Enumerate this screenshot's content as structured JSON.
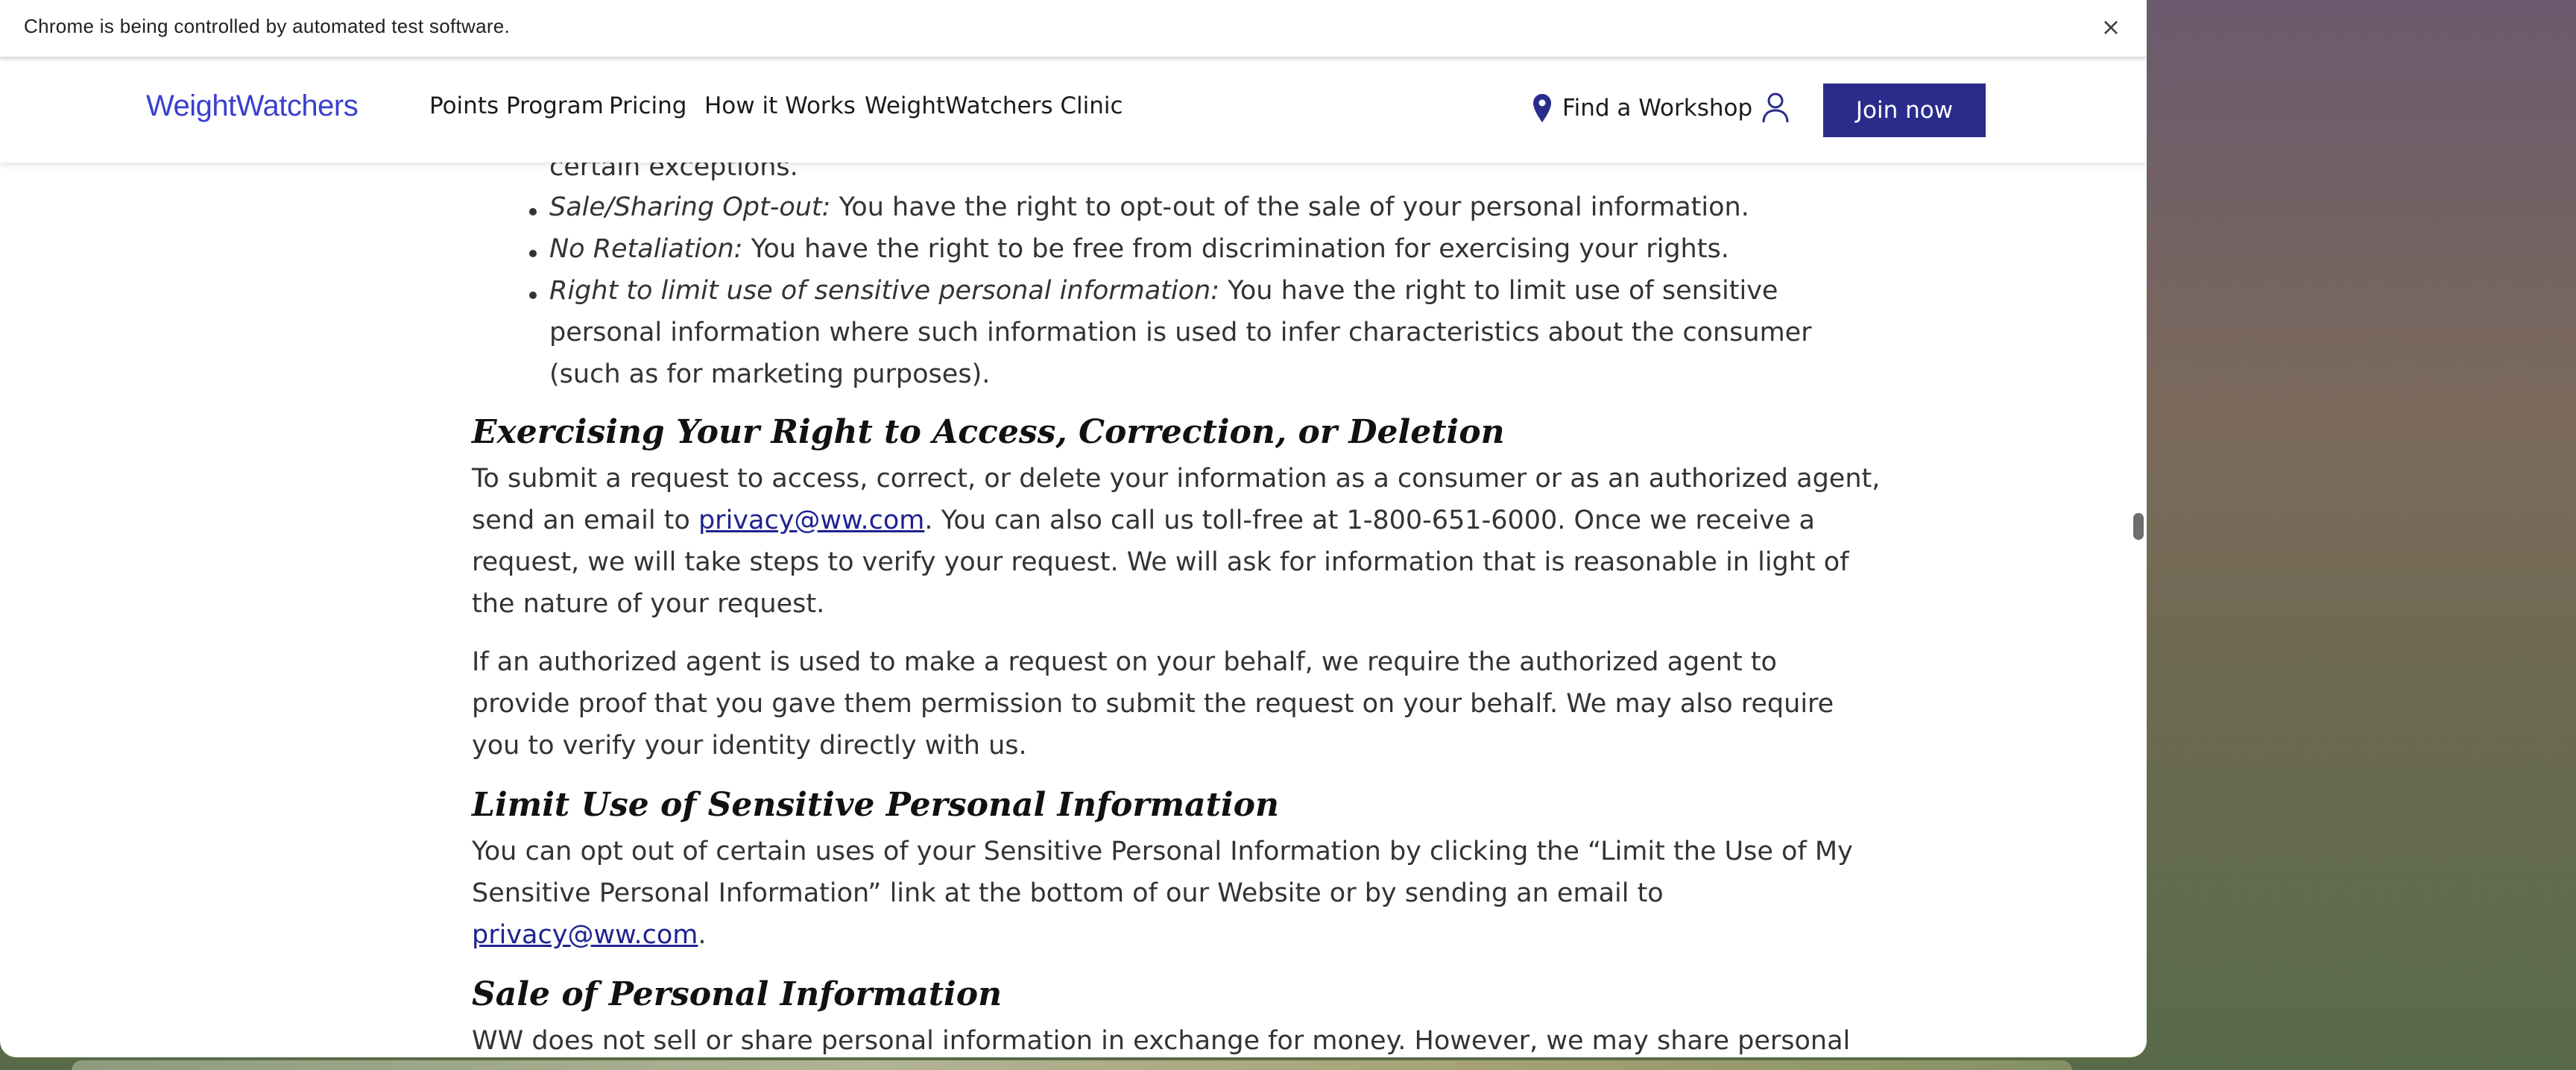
{
  "browser": {
    "infobar_text": "Chrome is being controlled by automated test software.",
    "close_glyph": "×"
  },
  "header": {
    "logo": "WeightWatchers",
    "nav": [
      "Points Program",
      "Pricing",
      "How it Works",
      "WeightWatchers Clinic"
    ],
    "find_workshop": "Find a Workshop",
    "join": "Join now",
    "colors": {
      "logo": "#3a3fd0",
      "join_bg": "#2a2c8c"
    }
  },
  "article": {
    "partial_line": "certain exceptions.",
    "bullets": [
      {
        "term": "Sale/Sharing Opt-out:",
        "text": " You have the right to opt-out of the sale of your personal information."
      },
      {
        "term": "No Retaliation:",
        "text": " You have the right to be free from discrimination for exercising your rights."
      },
      {
        "term": "Right to limit use of sensitive personal information:",
        "text": " You have the right to limit use of sensitive"
      }
    ],
    "bullet3_cont": [
      "personal information where such information is used to infer characteristics about the consumer",
      "(such as for marketing purposes)."
    ],
    "section1": {
      "title": "Exercising Your Right to Access, Correction, or Deletion",
      "p1": [
        "To submit a request to access, correct, or delete your information as a consumer or as an authorized agent,",
        "send an email to ",
        ". You can also call us toll-free at 1-800-651-6000. Once we receive a",
        "request, we will take steps to verify your request. We will ask for information that is reasonable in light of",
        "the nature of your request."
      ],
      "email": "privacy@ww.com",
      "p2": [
        "If an authorized agent is used to make a request on your behalf, we require the authorized agent to",
        "provide proof that you gave them permission to submit the request on your behalf. We may also require",
        "you to verify your identity directly with us."
      ]
    },
    "section2": {
      "title": "Limit Use of Sensitive Personal Information",
      "p1": [
        "You can opt out of certain uses of your Sensitive Personal Information by clicking the “Limit the Use of My",
        "Sensitive Personal Information” link at the bottom of our Website or by sending an email to"
      ],
      "email": "privacy@ww.com",
      "period": "."
    },
    "section3": {
      "title": "Sale of Personal Information",
      "p1": "WW does not sell or share personal information in exchange for money. However, we may share personal"
    }
  }
}
